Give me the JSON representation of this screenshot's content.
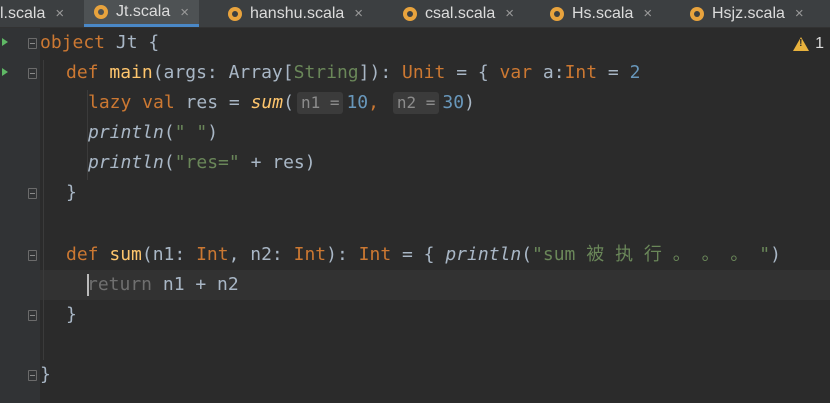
{
  "tabs": [
    {
      "label": "l.scala",
      "active": false
    },
    {
      "label": "Jt.scala",
      "active": true
    },
    {
      "label": "hanshu.scala",
      "active": false
    },
    {
      "label": "csal.scala",
      "active": false
    },
    {
      "label": "Hs.scala",
      "active": false
    },
    {
      "label": "Hsjz.scala",
      "active": false
    }
  ],
  "close_glyph": "×",
  "warnings": {
    "count": "1"
  },
  "code": {
    "l1": {
      "kw": "object",
      "name": " Jt {"
    },
    "l2": {
      "kw": "def ",
      "fn": "main",
      "p1": "(args: Array[",
      "str_type": "String",
      "p2": "]): ",
      "ty": "Unit",
      "p3": " = { ",
      "kw2": "var",
      "p4": " a:",
      "ty2": "Int",
      "p5": " = ",
      "num": "2"
    },
    "l3": {
      "kw": "lazy val ",
      "p1": "res = ",
      "fn": "sum",
      "p2": "(",
      "hint1": "n1 =",
      "num1": "10",
      "p3": ", ",
      "hint2": "n2 =",
      "num2": "30",
      "p4": ")"
    },
    "l4": {
      "fn": "println",
      "p1": "(",
      "str": "\" \"",
      "p2": ")"
    },
    "l5": {
      "fn": "println",
      "p1": "(",
      "str": "\"res=\"",
      "p2": " + res)"
    },
    "l6": {
      "text": "}"
    },
    "l8": {
      "kw": "def ",
      "fn": "sum",
      "p1": "(n1: ",
      "ty1": "Int",
      "p2": ", n2: ",
      "ty2": "Int",
      "p3": "): ",
      "ty3": "Int",
      "p4": " = { ",
      "fn2": "println",
      "p5": "(",
      "str": "\"sum 被 执 行 。 。 。 \"",
      "p6": ")"
    },
    "l9": {
      "kw": "return",
      "p1": " n1 + n2"
    },
    "l10": {
      "text": "}"
    },
    "l12": {
      "text": "}"
    }
  }
}
